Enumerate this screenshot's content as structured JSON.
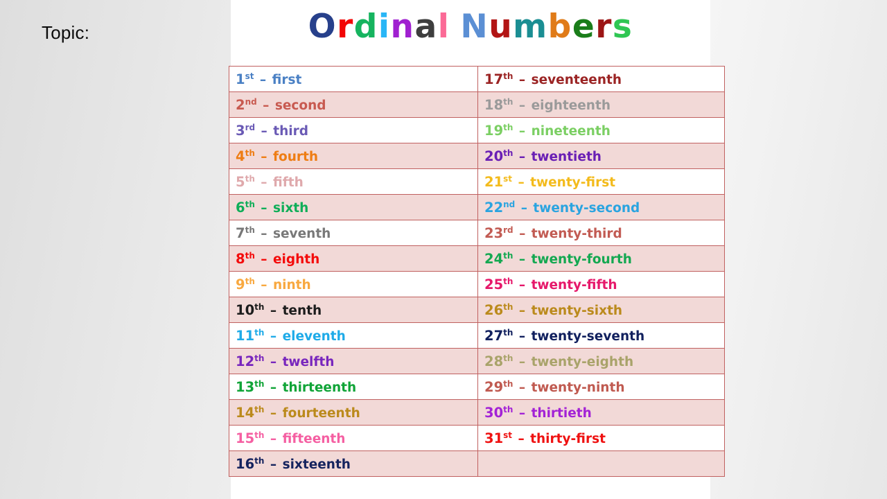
{
  "slide": {
    "topic_label": "Topic:",
    "panel_background": "#ffffff",
    "page_background": "#ededed"
  },
  "title": {
    "text": "Ordinal Numbers",
    "letters": [
      {
        "ch": "O",
        "color": "#27408b"
      },
      {
        "ch": "r",
        "color": "#f20505"
      },
      {
        "ch": "d",
        "color": "#16b45f"
      },
      {
        "ch": "i",
        "color": "#29b6f6"
      },
      {
        "ch": "n",
        "color": "#a020d0"
      },
      {
        "ch": "a",
        "color": "#3e3e3e"
      },
      {
        "ch": "l",
        "color": "#fb6a96"
      },
      {
        "ch": " ",
        "color": "#ffffff"
      },
      {
        "ch": "N",
        "color": "#5b8fd4"
      },
      {
        "ch": "u",
        "color": "#b21515"
      },
      {
        "ch": "m",
        "color": "#1b8e93"
      },
      {
        "ch": "b",
        "color": "#e07b18"
      },
      {
        "ch": "e",
        "color": "#1a7d1a"
      },
      {
        "ch": "r",
        "color": "#9c1515"
      },
      {
        "ch": "s",
        "color": "#2fc653"
      }
    ]
  },
  "table": {
    "border_color": "#c0605f",
    "alt_row_color": "#f2d9d7",
    "plain_row_color": "#ffffff",
    "dash": "–",
    "rows": [
      {
        "shaded": false,
        "left": {
          "num": "1",
          "suffix": "st",
          "word": "first",
          "color": "#4a80c4"
        },
        "right": {
          "num": "17",
          "suffix": "th",
          "word": "seventeenth",
          "color": "#9b2424"
        }
      },
      {
        "shaded": true,
        "left": {
          "num": "2",
          "suffix": "nd",
          "word": "second",
          "color": "#c85a50"
        },
        "right": {
          "num": "18",
          "suffix": "th",
          "word": "eighteenth",
          "color": "#9a9a9a"
        }
      },
      {
        "shaded": false,
        "left": {
          "num": "3",
          "suffix": "rd",
          "word": "third",
          "color": "#6a5ab5"
        },
        "right": {
          "num": "19",
          "suffix": "th",
          "word": "nineteenth",
          "color": "#7bcf63"
        }
      },
      {
        "shaded": true,
        "left": {
          "num": "4",
          "suffix": "th",
          "word": "fourth",
          "color": "#ee7d14"
        },
        "right": {
          "num": "20",
          "suffix": "th",
          "word": "twentieth",
          "color": "#6a1fb5"
        }
      },
      {
        "shaded": false,
        "left": {
          "num": "5",
          "suffix": "th",
          "word": "fifth",
          "color": "#dfa9ac"
        },
        "right": {
          "num": "21",
          "suffix": "st",
          "word": "twenty-first",
          "color": "#f3bb1c"
        }
      },
      {
        "shaded": true,
        "left": {
          "num": "6",
          "suffix": "th",
          "word": "sixth",
          "color": "#0fae58"
        },
        "right": {
          "num": "22",
          "suffix": "nd",
          "word": "twenty-second",
          "color": "#2aa4e0"
        }
      },
      {
        "shaded": false,
        "left": {
          "num": "7",
          "suffix": "th",
          "word": "seventh",
          "color": "#787878"
        },
        "right": {
          "num": "23",
          "suffix": "rd",
          "word": "twenty-third",
          "color": "#c25b53"
        }
      },
      {
        "shaded": true,
        "left": {
          "num": "8",
          "suffix": "th",
          "word": "eighth",
          "color": "#f40b0b"
        },
        "right": {
          "num": "24",
          "suffix": "th",
          "word": "twenty-fourth",
          "color": "#14a851"
        }
      },
      {
        "shaded": false,
        "left": {
          "num": "9",
          "suffix": "th",
          "word": "ninth",
          "color": "#f8a83f"
        },
        "right": {
          "num": "25",
          "suffix": "th",
          "word": "twenty-fifth",
          "color": "#e6186a"
        }
      },
      {
        "shaded": true,
        "left": {
          "num": "10",
          "suffix": "th",
          "word": "tenth",
          "color": "#1c1c1c"
        },
        "right": {
          "num": "26",
          "suffix": "th",
          "word": "twenty-sixth",
          "color": "#bb8a1c"
        }
      },
      {
        "shaded": false,
        "left": {
          "num": "11",
          "suffix": "th",
          "word": "eleventh",
          "color": "#1fabe8"
        },
        "right": {
          "num": "27",
          "suffix": "th",
          "word": "twenty-seventh",
          "color": "#11205e"
        }
      },
      {
        "shaded": true,
        "left": {
          "num": "12",
          "suffix": "th",
          "word": "twelfth",
          "color": "#7826bd"
        },
        "right": {
          "num": "28",
          "suffix": "th",
          "word": "twenty-eighth",
          "color": "#a9a36a"
        }
      },
      {
        "shaded": false,
        "left": {
          "num": "13",
          "suffix": "th",
          "word": "thirteenth",
          "color": "#10a437"
        },
        "right": {
          "num": "29",
          "suffix": "th",
          "word": "twenty-ninth",
          "color": "#c05a50"
        }
      },
      {
        "shaded": true,
        "left": {
          "num": "14",
          "suffix": "th",
          "word": "fourteenth",
          "color": "#bb8a1c"
        },
        "right": {
          "num": "30",
          "suffix": "th",
          "word": "thirtieth",
          "color": "#a322d6"
        }
      },
      {
        "shaded": false,
        "left": {
          "num": "15",
          "suffix": "th",
          "word": "fifteenth",
          "color": "#f55fa2"
        },
        "right": {
          "num": "31",
          "suffix": "st",
          "word": "thirty-first",
          "color": "#ef1111"
        }
      },
      {
        "shaded": true,
        "left": {
          "num": "16",
          "suffix": "th",
          "word": "sixteenth",
          "color": "#15235e"
        },
        "right": null
      }
    ]
  }
}
